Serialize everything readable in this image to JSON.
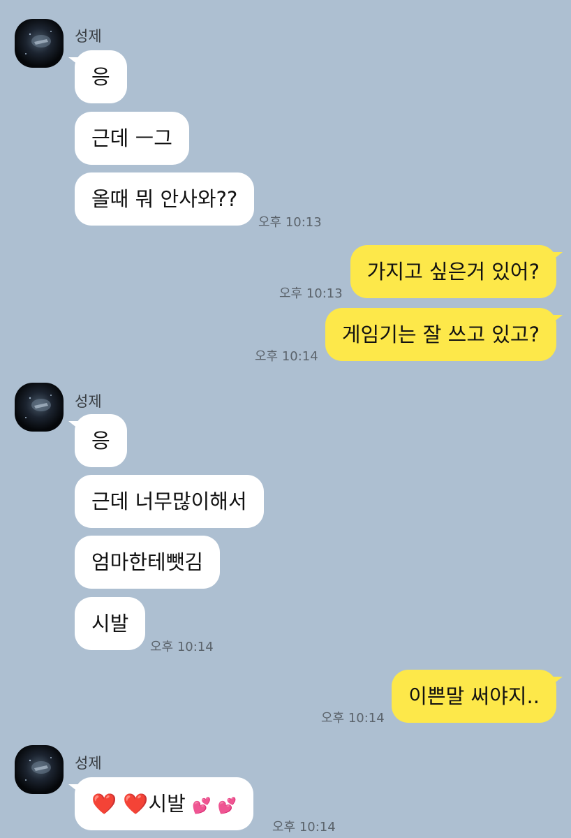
{
  "groups": [
    {
      "sender": "성제",
      "messages": [
        "응",
        "근데 ㅡ그",
        "올때 뭐 안사와??"
      ],
      "time": "오후 10:13"
    },
    {
      "messages": [
        "가지고 싶은거 있어?"
      ],
      "time": "오후 10:13"
    },
    {
      "messages": [
        "게임기는 잘 쓰고 있고?"
      ],
      "time": "오후 10:14"
    },
    {
      "sender": "성제",
      "messages": [
        "응",
        "근데 너무많이해서",
        "엄마한테뺏김",
        "시발"
      ],
      "time": "오후 10:14"
    },
    {
      "messages": [
        "이쁜말 써야지.."
      ],
      "time": "오후 10:14"
    },
    {
      "sender": "성제",
      "messages": [
        "❤️",
        "❤️",
        "시발",
        "💕",
        "💕"
      ],
      "time": "오후 10:14"
    }
  ],
  "colors": {
    "background": "#adbfd1",
    "incoming_bubble": "#ffffff",
    "outgoing_bubble": "#fde84a"
  },
  "icons": {
    "avatar": "profile-photo",
    "heart": "red-heart-emoji",
    "two_hearts": "two-hearts-emoji"
  }
}
